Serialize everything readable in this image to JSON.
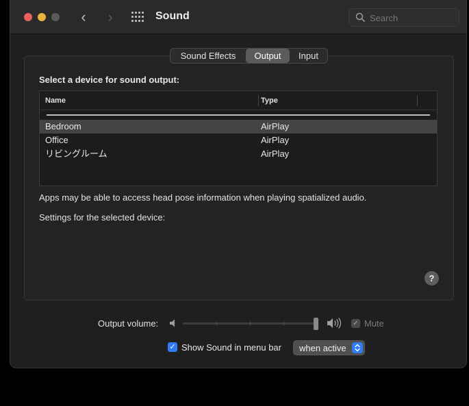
{
  "window": {
    "title": "Sound"
  },
  "toolbar": {
    "back_arrow": "‹",
    "forward_arrow": "›",
    "search_placeholder": "Search"
  },
  "tabs": [
    {
      "label": "Sound Effects",
      "selected": false
    },
    {
      "label": "Output",
      "selected": true
    },
    {
      "label": "Input",
      "selected": false
    }
  ],
  "output": {
    "section_label": "Select a device for sound output:",
    "columns": {
      "name": "Name",
      "type": "Type"
    },
    "devices": [
      {
        "name": "Bedroom",
        "type": "AirPlay",
        "selected": true
      },
      {
        "name": "Office",
        "type": "AirPlay",
        "selected": false
      },
      {
        "name": "リビングルーム",
        "type": "AirPlay",
        "selected": false
      }
    ],
    "info_text": "Apps may be able to access head pose information when playing spatialized audio.",
    "settings_label": "Settings for the selected device:",
    "help_label": "?"
  },
  "volume": {
    "label": "Output volume:",
    "level": 1.0,
    "mute_label": "Mute",
    "mute_checked": true,
    "mute_enabled": false
  },
  "menubar": {
    "show_label": "Show Sound in menu bar",
    "show_checked": true,
    "when_option": "when active"
  },
  "colors": {
    "accent": "#2f7cf6",
    "close": "#ec5f5a",
    "minimize": "#e6b43e"
  }
}
